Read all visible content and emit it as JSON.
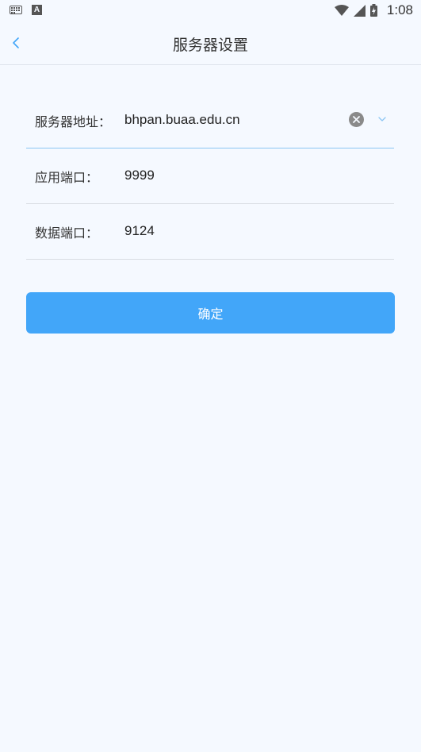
{
  "status_bar": {
    "time": "1:08",
    "left_icons": [
      "keyboard-icon",
      "a-icon"
    ],
    "a_icon_letter": "A",
    "right_icons": [
      "wifi-icon",
      "signal-icon",
      "battery-charging-icon"
    ]
  },
  "header": {
    "title": "服务器设置",
    "back_icon": "chevron-left-icon"
  },
  "form": {
    "server_address": {
      "label": "服务器地址：",
      "value": "bhpan.buaa.edu.cn"
    },
    "app_port": {
      "label": "应用端口：",
      "value": "9999"
    },
    "data_port": {
      "label": "数据端口：",
      "value": "9124"
    }
  },
  "confirm_button": {
    "label": "确定"
  },
  "colors": {
    "background": "#f5f9ff",
    "accent": "#42a6f9",
    "active_underline": "#8cc6f3",
    "divider": "#d9dde3"
  }
}
